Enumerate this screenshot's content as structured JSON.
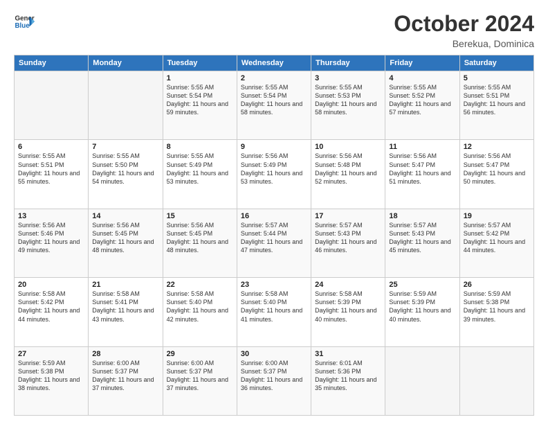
{
  "header": {
    "logo_line1": "General",
    "logo_line2": "Blue",
    "title": "October 2024",
    "subtitle": "Berekua, Dominica"
  },
  "columns": [
    "Sunday",
    "Monday",
    "Tuesday",
    "Wednesday",
    "Thursday",
    "Friday",
    "Saturday"
  ],
  "weeks": [
    [
      {
        "day": "",
        "info": ""
      },
      {
        "day": "",
        "info": ""
      },
      {
        "day": "1",
        "info": "Sunrise: 5:55 AM\nSunset: 5:54 PM\nDaylight: 11 hours and 59 minutes."
      },
      {
        "day": "2",
        "info": "Sunrise: 5:55 AM\nSunset: 5:54 PM\nDaylight: 11 hours and 58 minutes."
      },
      {
        "day": "3",
        "info": "Sunrise: 5:55 AM\nSunset: 5:53 PM\nDaylight: 11 hours and 58 minutes."
      },
      {
        "day": "4",
        "info": "Sunrise: 5:55 AM\nSunset: 5:52 PM\nDaylight: 11 hours and 57 minutes."
      },
      {
        "day": "5",
        "info": "Sunrise: 5:55 AM\nSunset: 5:51 PM\nDaylight: 11 hours and 56 minutes."
      }
    ],
    [
      {
        "day": "6",
        "info": "Sunrise: 5:55 AM\nSunset: 5:51 PM\nDaylight: 11 hours and 55 minutes."
      },
      {
        "day": "7",
        "info": "Sunrise: 5:55 AM\nSunset: 5:50 PM\nDaylight: 11 hours and 54 minutes."
      },
      {
        "day": "8",
        "info": "Sunrise: 5:55 AM\nSunset: 5:49 PM\nDaylight: 11 hours and 53 minutes."
      },
      {
        "day": "9",
        "info": "Sunrise: 5:56 AM\nSunset: 5:49 PM\nDaylight: 11 hours and 53 minutes."
      },
      {
        "day": "10",
        "info": "Sunrise: 5:56 AM\nSunset: 5:48 PM\nDaylight: 11 hours and 52 minutes."
      },
      {
        "day": "11",
        "info": "Sunrise: 5:56 AM\nSunset: 5:47 PM\nDaylight: 11 hours and 51 minutes."
      },
      {
        "day": "12",
        "info": "Sunrise: 5:56 AM\nSunset: 5:47 PM\nDaylight: 11 hours and 50 minutes."
      }
    ],
    [
      {
        "day": "13",
        "info": "Sunrise: 5:56 AM\nSunset: 5:46 PM\nDaylight: 11 hours and 49 minutes."
      },
      {
        "day": "14",
        "info": "Sunrise: 5:56 AM\nSunset: 5:45 PM\nDaylight: 11 hours and 48 minutes."
      },
      {
        "day": "15",
        "info": "Sunrise: 5:56 AM\nSunset: 5:45 PM\nDaylight: 11 hours and 48 minutes."
      },
      {
        "day": "16",
        "info": "Sunrise: 5:57 AM\nSunset: 5:44 PM\nDaylight: 11 hours and 47 minutes."
      },
      {
        "day": "17",
        "info": "Sunrise: 5:57 AM\nSunset: 5:43 PM\nDaylight: 11 hours and 46 minutes."
      },
      {
        "day": "18",
        "info": "Sunrise: 5:57 AM\nSunset: 5:43 PM\nDaylight: 11 hours and 45 minutes."
      },
      {
        "day": "19",
        "info": "Sunrise: 5:57 AM\nSunset: 5:42 PM\nDaylight: 11 hours and 44 minutes."
      }
    ],
    [
      {
        "day": "20",
        "info": "Sunrise: 5:58 AM\nSunset: 5:42 PM\nDaylight: 11 hours and 44 minutes."
      },
      {
        "day": "21",
        "info": "Sunrise: 5:58 AM\nSunset: 5:41 PM\nDaylight: 11 hours and 43 minutes."
      },
      {
        "day": "22",
        "info": "Sunrise: 5:58 AM\nSunset: 5:40 PM\nDaylight: 11 hours and 42 minutes."
      },
      {
        "day": "23",
        "info": "Sunrise: 5:58 AM\nSunset: 5:40 PM\nDaylight: 11 hours and 41 minutes."
      },
      {
        "day": "24",
        "info": "Sunrise: 5:58 AM\nSunset: 5:39 PM\nDaylight: 11 hours and 40 minutes."
      },
      {
        "day": "25",
        "info": "Sunrise: 5:59 AM\nSunset: 5:39 PM\nDaylight: 11 hours and 40 minutes."
      },
      {
        "day": "26",
        "info": "Sunrise: 5:59 AM\nSunset: 5:38 PM\nDaylight: 11 hours and 39 minutes."
      }
    ],
    [
      {
        "day": "27",
        "info": "Sunrise: 5:59 AM\nSunset: 5:38 PM\nDaylight: 11 hours and 38 minutes."
      },
      {
        "day": "28",
        "info": "Sunrise: 6:00 AM\nSunset: 5:37 PM\nDaylight: 11 hours and 37 minutes."
      },
      {
        "day": "29",
        "info": "Sunrise: 6:00 AM\nSunset: 5:37 PM\nDaylight: 11 hours and 37 minutes."
      },
      {
        "day": "30",
        "info": "Sunrise: 6:00 AM\nSunset: 5:37 PM\nDaylight: 11 hours and 36 minutes."
      },
      {
        "day": "31",
        "info": "Sunrise: 6:01 AM\nSunset: 5:36 PM\nDaylight: 11 hours and 35 minutes."
      },
      {
        "day": "",
        "info": ""
      },
      {
        "day": "",
        "info": ""
      }
    ]
  ]
}
